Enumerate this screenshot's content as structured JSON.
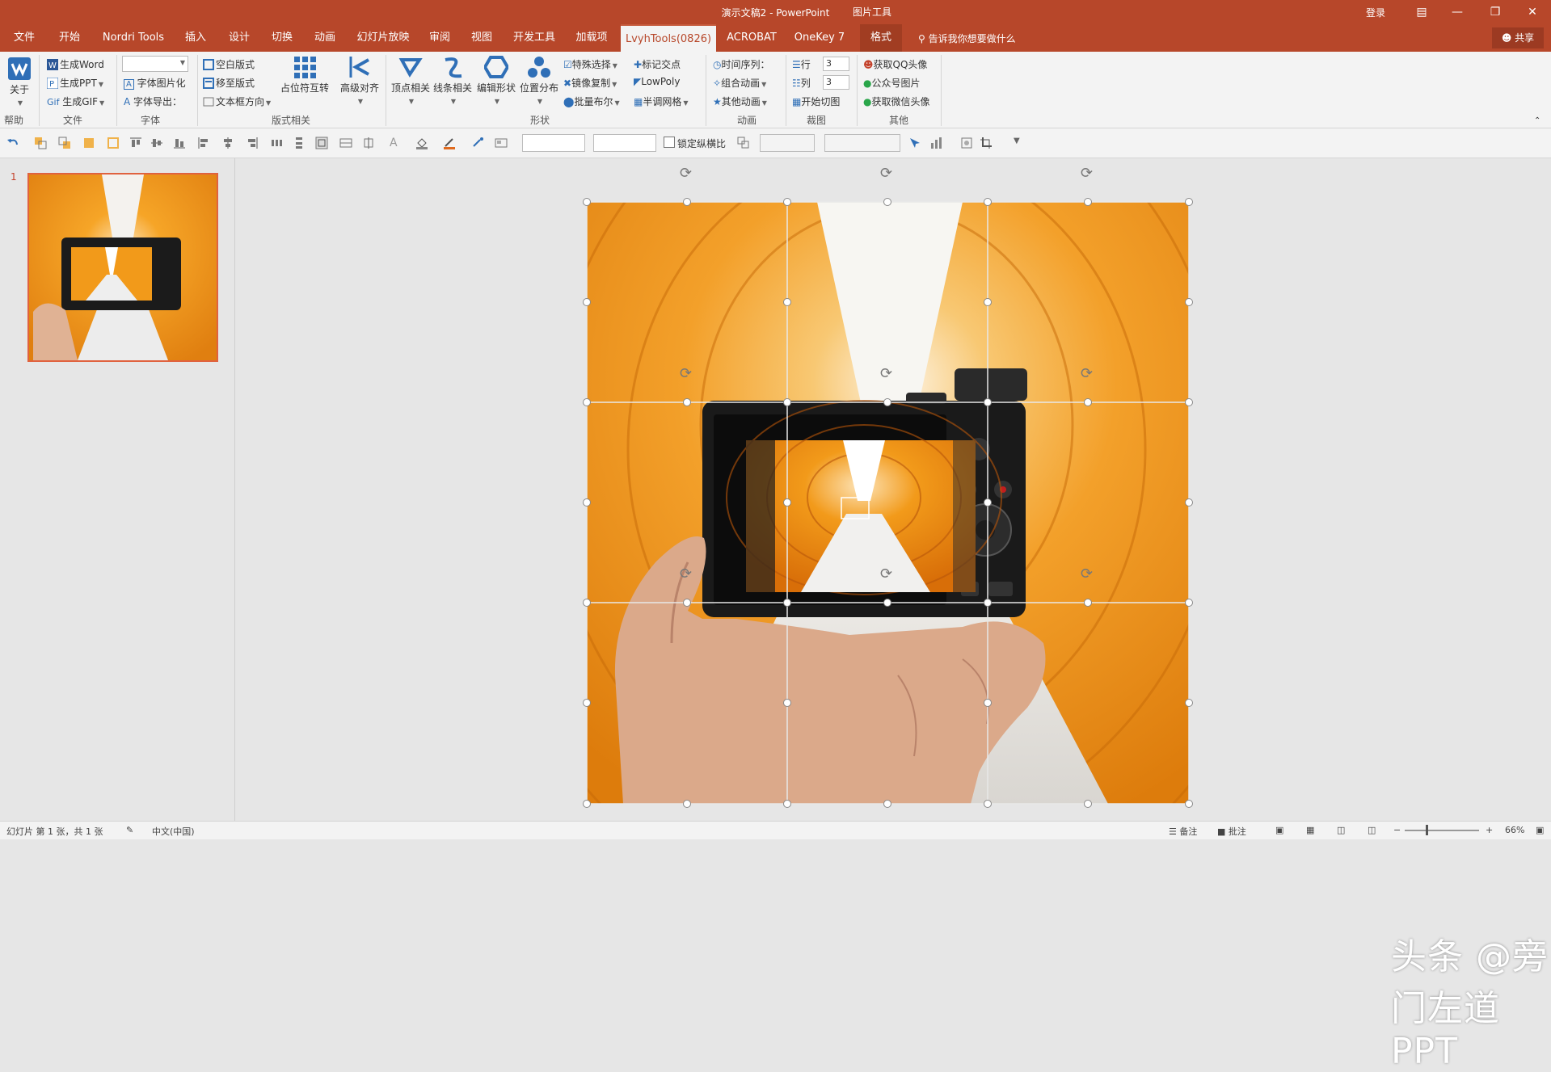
{
  "window": {
    "title": "演示文稿2 - PowerPoint",
    "context_tool": "图片工具",
    "login": "登录",
    "buttons": [
      "ribbon-display",
      "minimize",
      "restore",
      "close"
    ]
  },
  "tabs": [
    {
      "label": "文件",
      "active": false
    },
    {
      "label": "开始",
      "active": false
    },
    {
      "label": "Nordri Tools",
      "active": false
    },
    {
      "label": "插入",
      "active": false
    },
    {
      "label": "设计",
      "active": false
    },
    {
      "label": "切换",
      "active": false
    },
    {
      "label": "动画",
      "active": false
    },
    {
      "label": "幻灯片放映",
      "active": false
    },
    {
      "label": "审阅",
      "active": false
    },
    {
      "label": "视图",
      "active": false
    },
    {
      "label": "开发工具",
      "active": false
    },
    {
      "label": "加载项",
      "active": false
    },
    {
      "label": "LvyhTools(0826)",
      "active": true
    },
    {
      "label": "ACROBAT",
      "active": false
    },
    {
      "label": "OneKey 7",
      "active": false
    },
    {
      "label": "格式",
      "active": false
    }
  ],
  "tell_me": "告诉我你想要做什么",
  "share": "共享",
  "ribbon": {
    "groups": [
      "帮助",
      "文件",
      "字体",
      "版式相关",
      "形状",
      "动画",
      "裁图",
      "其他"
    ],
    "about": "关于",
    "file_items": [
      "生成Word",
      "生成PPT",
      "生成GIF"
    ],
    "font_items": [
      "字体图片化",
      "字体导出："
    ],
    "layout_items": [
      "空白版式",
      "移至版式",
      "文本框方向"
    ],
    "placeholder_swap": "占位符互转",
    "advanced_align": "高级对齐",
    "shape_big": [
      "顶点相关",
      "线条相关",
      "编辑形状",
      "位置分布"
    ],
    "shape_small_a": [
      "特殊选择",
      "镜像复制",
      "批量布尔"
    ],
    "shape_small_b": [
      "标记交点",
      "LowPoly",
      "半调网格"
    ],
    "anim_items": [
      "时间序列：",
      "组合动画",
      "其他动画"
    ],
    "crop": {
      "row_label": "行",
      "row_value": "3",
      "col_label": "列",
      "col_value": "3",
      "start": "开始切图"
    },
    "other_items": [
      "获取QQ头像",
      "公众号图片",
      "获取微信头像"
    ]
  },
  "qat": {
    "lock_aspect": "锁定纵横比"
  },
  "slides": {
    "current": "1"
  },
  "watermark": "头条 @旁门左道PPT",
  "status": {
    "slide_info": "幻灯片 第 1 张，共 1 张",
    "language": "中文(中国)",
    "notes": "备注",
    "comments": "批注",
    "zoom": "66%"
  },
  "colors": {
    "accent": "#b7472a",
    "tunnel_orange": "#f29a1a",
    "selection_grid": "#ffffff"
  }
}
